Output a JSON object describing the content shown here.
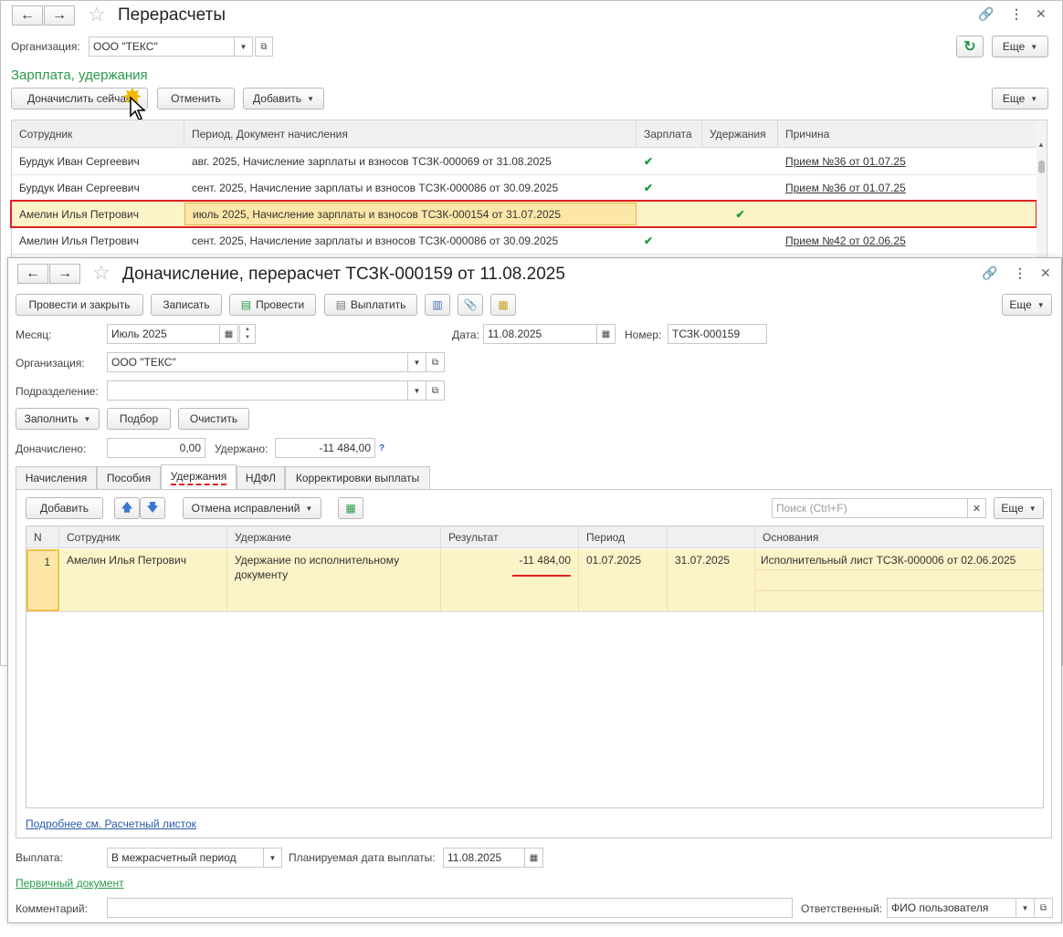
{
  "back_window": {
    "title": "Перерасчеты",
    "org_label": "Организация:",
    "org_value": "ООО \"ТЕКС\"",
    "more_label": "Еще",
    "section_title": "Зарплата, удержания",
    "btn_recalc": "Доначислить сейчас",
    "btn_cancel": "Отменить",
    "btn_add": "Добавить",
    "columns": [
      "Сотрудник",
      "Период, Документ начисления",
      "Зарплата",
      "Удержания",
      "Причина"
    ],
    "rows": [
      {
        "employee": "Бурдук Иван Сергеевич",
        "period": "авг. 2025, Начисление зарплаты и взносов ТСЗК-000069 от 31.08.2025",
        "salary": "✔",
        "deduction": "",
        "reason": "Прием №36 от 01.07.25"
      },
      {
        "employee": "Бурдук Иван Сергеевич",
        "period": "сент. 2025, Начисление зарплаты и взносов ТСЗК-000086 от 30.09.2025",
        "salary": "✔",
        "deduction": "",
        "reason": "Прием №36 от 01.07.25"
      },
      {
        "employee": "Амелин Илья Петрович",
        "period": "июль 2025, Начисление зарплаты и взносов ТСЗК-000154 от 31.07.2025",
        "salary": "",
        "deduction": "✔",
        "reason": ""
      },
      {
        "employee": "Амелин Илья Петрович",
        "period": "сент. 2025, Начисление зарплаты и взносов ТСЗК-000086 от 30.09.2025",
        "salary": "✔",
        "deduction": "",
        "reason": "Прием №42 от 02.06.25"
      }
    ]
  },
  "front_window": {
    "title": "Доначисление, перерасчет ТСЗК-000159 от 11.08.2025",
    "toolbar": {
      "post_close": "Провести и закрыть",
      "save": "Записать",
      "post": "Провести",
      "pay": "Выплатить",
      "more": "Еще"
    },
    "month_label": "Месяц:",
    "month_value": "Июль 2025",
    "date_label": "Дата:",
    "date_value": "11.08.2025",
    "number_label": "Номер:",
    "number_value": "ТСЗК-000159",
    "org_label": "Организация:",
    "org_value": "ООО \"ТЕКС\"",
    "dept_label": "Подразделение:",
    "dept_value": "",
    "btn_fill": "Заполнить",
    "btn_pick": "Подбор",
    "btn_clear": "Очистить",
    "accrued_label": "Доначислено:",
    "accrued_value": "0,00",
    "withheld_label": "Удержано:",
    "withheld_value": "-11 484,00",
    "help_mark": "?",
    "tabs": [
      "Начисления",
      "Пособия",
      "Удержания",
      "НДФЛ",
      "Корректировки выплаты"
    ],
    "inner_toolbar": {
      "add": "Добавить",
      "cancel_fix": "Отмена исправлений",
      "search_placeholder": "Поиск (Ctrl+F)",
      "more": "Еще"
    },
    "columns": [
      "N",
      "Сотрудник",
      "Удержание",
      "Результат",
      "Период",
      "",
      "Основания"
    ],
    "row": {
      "n": "1",
      "employee": "Амелин Илья Петрович",
      "deduction_line1": "Удержание по исполнительному",
      "deduction_line2": "документу",
      "result": "-11 484,00",
      "period_from": "01.07.2025",
      "period_to": "31.07.2025",
      "basis": "Исполнительный лист ТСЗК-000006 от 02.06.2025"
    },
    "details_link": "Подробнее см. Расчетный листок",
    "payout_label": "Выплата:",
    "payout_value": "В межрасчетный период",
    "planned_label": "Планируемая дата выплаты:",
    "planned_value": "11.08.2025",
    "primary_doc": "Первичный документ",
    "comment_label": "Комментарий:",
    "comment_value": "",
    "responsible_label": "Ответственный:",
    "responsible_value": "ФИО пользователя"
  },
  "colors": {
    "accent_green": "#2a9a4a",
    "highlight_row": "#fdf3c8",
    "selection_border": "#e02020",
    "check_green": "#1e9a3a"
  }
}
